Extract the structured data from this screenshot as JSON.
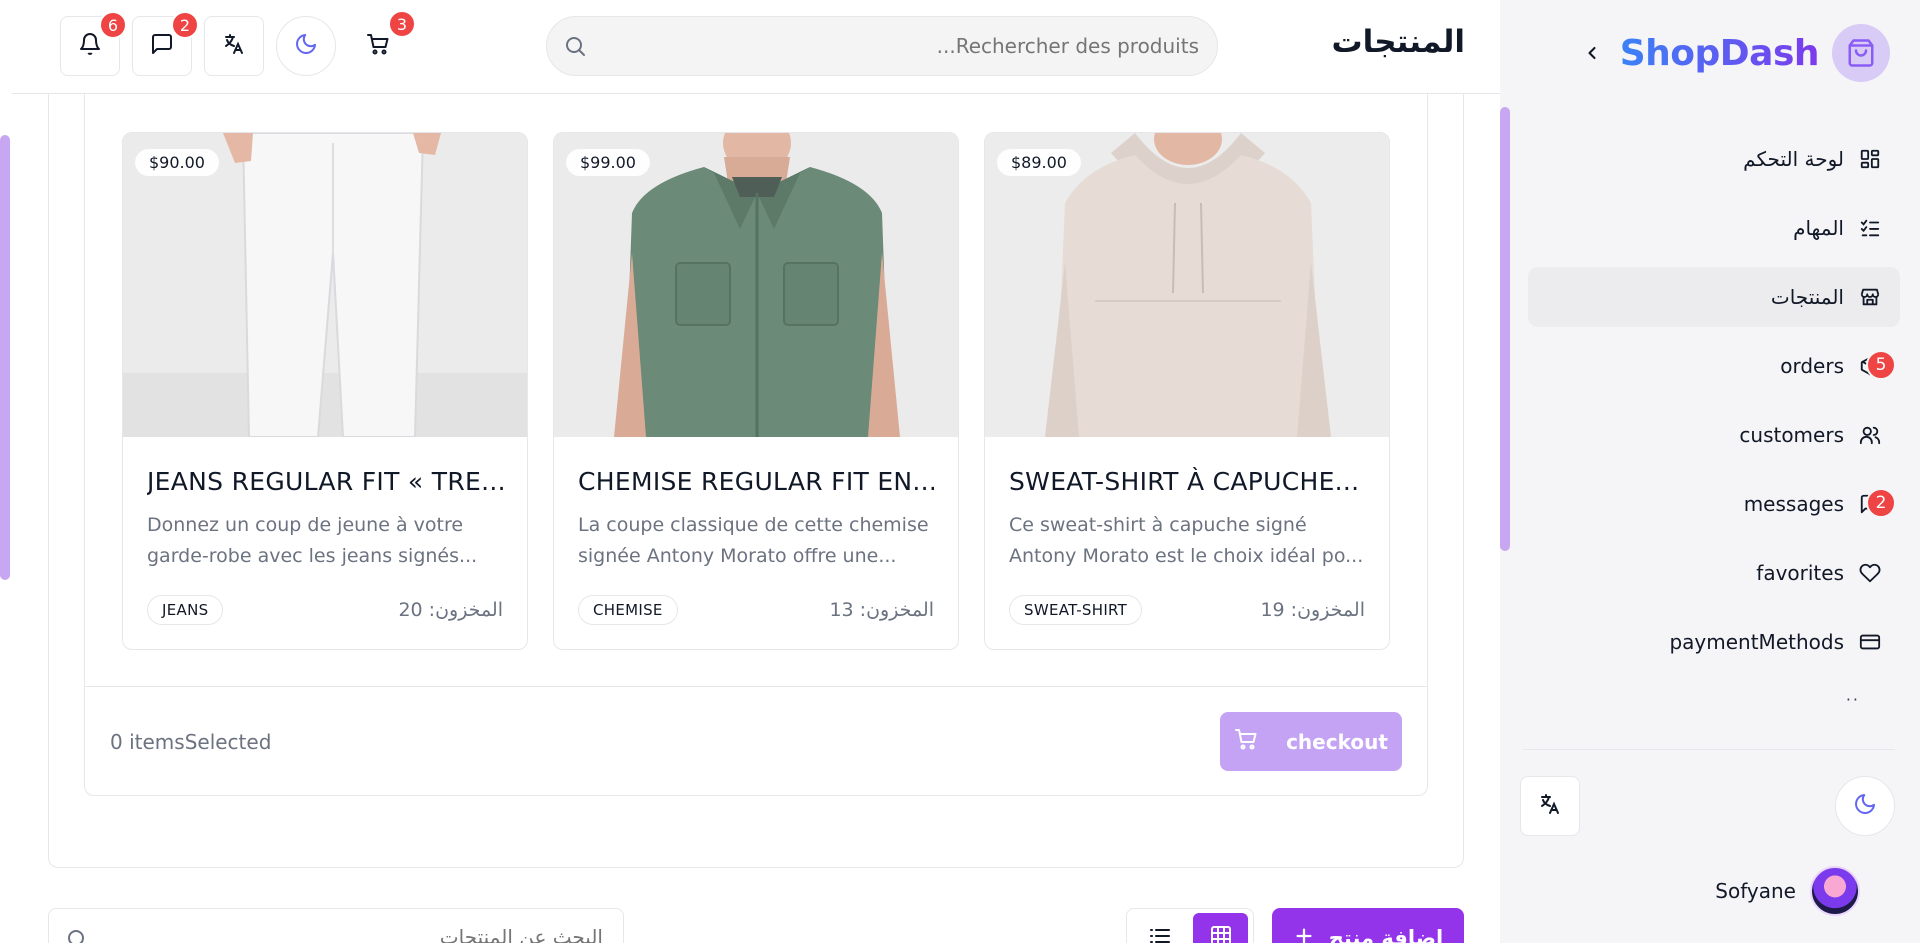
{
  "sidebar": {
    "brand": "ShopDash",
    "items": [
      {
        "label": "لوحة التحكم",
        "icon": "dashboard-grid-icon",
        "active": false,
        "badge": ""
      },
      {
        "label": "المهام",
        "icon": "tasks-list-icon",
        "active": false,
        "badge": ""
      },
      {
        "label": "المنتجات",
        "icon": "store-icon",
        "active": true,
        "badge": ""
      },
      {
        "label": "orders",
        "icon": "package-icon",
        "active": false,
        "badge": "5"
      },
      {
        "label": "customers",
        "icon": "users-icon",
        "active": false,
        "badge": ""
      },
      {
        "label": "messages",
        "icon": "message-icon",
        "active": false,
        "badge": "2"
      },
      {
        "label": "favorites",
        "icon": "heart-icon",
        "active": false,
        "badge": ""
      },
      {
        "label": "paymentMethods",
        "icon": "credit-card-icon",
        "active": false,
        "badge": ""
      }
    ],
    "more": "··",
    "user_name": "Sofyane"
  },
  "header": {
    "title": "المنتجات",
    "search_placeholder": "...Rechercher des produits",
    "notifications_count": "6",
    "messages_count": "2",
    "cart_count": "3"
  },
  "products": [
    {
      "price": "$90.00",
      "title": "JEANS REGULAR FIT « TRE...",
      "description": "Donnez un coup de jeune à votre garde-robe avec les jeans signés...",
      "category": "JEANS",
      "stock": "المخزون: 20"
    },
    {
      "price": "$99.00",
      "title": "CHEMISE REGULAR FIT EN...",
      "description": "La coupe classique de cette chemise signée Antony Morato offre une...",
      "category": "CHEMISE",
      "stock": "المخزون: 13"
    },
    {
      "price": "$89.00",
      "title": "SWEAT-SHIRT À CAPUCHE...",
      "description": "Ce sweat-shirt à capuche signé Antony Morato est le choix idéal po...",
      "category": "SWEAT-SHIRT",
      "stock": "المخزون: 19"
    }
  ],
  "footer": {
    "items_selected": "0 itemsSelected",
    "checkout_label": "checkout"
  },
  "toolbar": {
    "search_placeholder": "البحث عن المنتجات",
    "add_label": "إضافة منتج"
  },
  "colors": {
    "accent": "#9333ea",
    "accent_light": "#c4a3f5",
    "badge": "#ef4444",
    "sidebar_bg": "#f5f5f7"
  }
}
